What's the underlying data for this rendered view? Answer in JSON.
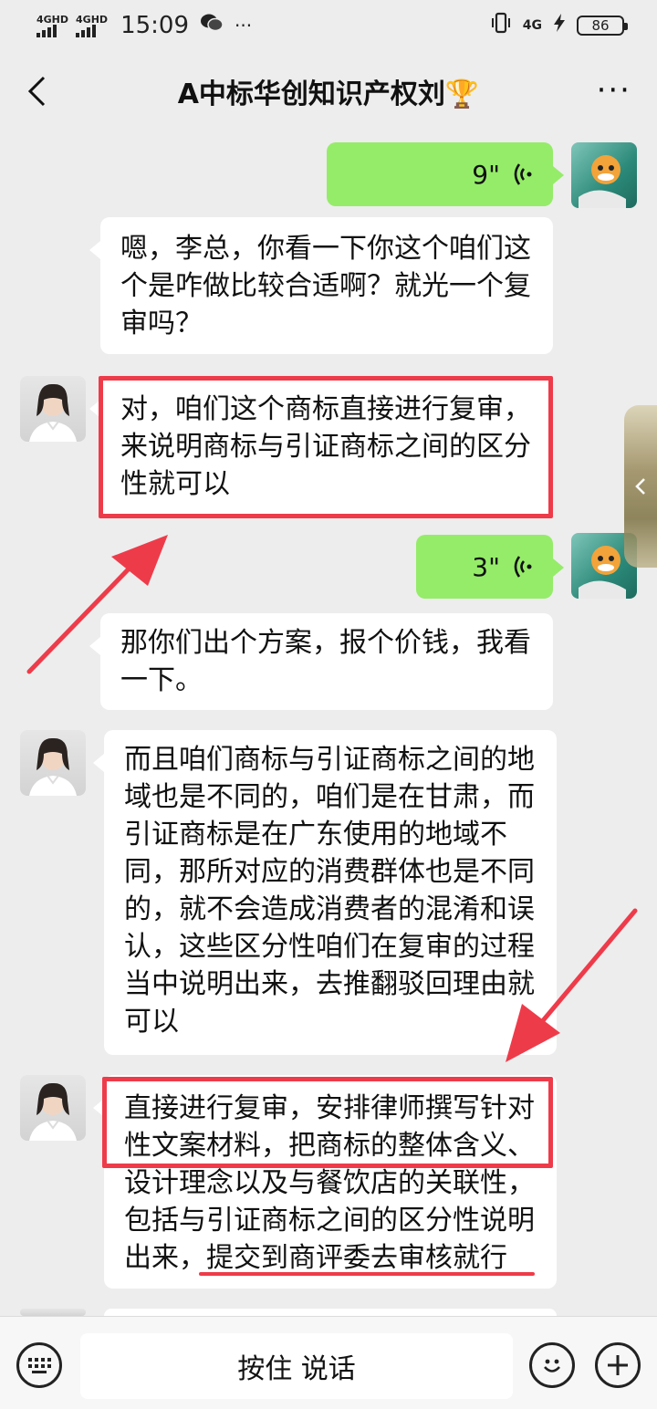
{
  "status_bar": {
    "signal1": "4GHD",
    "signal2": "4GHD",
    "time": "15:09",
    "net_type": "4G",
    "battery": "86"
  },
  "header": {
    "title": "A中标华创知识产权刘🏆",
    "back_icon": "chevron-left-icon",
    "more_label": "···"
  },
  "messages": [
    {
      "side": "right",
      "type": "voice",
      "duration": "9\""
    },
    {
      "side": "left",
      "type": "text",
      "lines": [
        "嗯，李总，你看一下你这个咱们这",
        "个是咋做比较合适啊？就光一个复",
        "审吗？"
      ]
    },
    {
      "side": "left",
      "type": "text",
      "lines": [
        "对，咱们这个商标直接进行复审，",
        "来说明商标与引证商标之间的区分",
        "性就可以"
      ]
    },
    {
      "side": "right",
      "type": "voice",
      "duration": "3\""
    },
    {
      "side": "left",
      "type": "text",
      "lines": [
        "那你们出个方案，报个价钱，我看",
        "一下。"
      ]
    },
    {
      "side": "left",
      "type": "text",
      "lines": [
        "而且咱们商标与引证商标之间的地",
        "域也是不同的，咱们是在甘肃，而",
        "引证商标是在广东使用的地域不",
        "同，那所对应的消费群体也是不同",
        "的，就不会造成消费者的混淆和误",
        "认，这些区分性咱们在复审的过程",
        "当中说明出来，去推翻驳回理由就",
        "可以"
      ]
    },
    {
      "side": "left",
      "type": "text",
      "lines": [
        "直接进行复审，安排律师撰写针对",
        "性文案材料，把商标的整体含义、",
        "设计理念以及与餐饮店的关联性，",
        "包括与引证商标之间的区分性说明",
        "出来，提交到商评委去审核就行"
      ]
    }
  ],
  "input_bar": {
    "talk_label": "按住 说话",
    "keyboard_icon": "keyboard-icon",
    "emoji_icon": "emoji-icon",
    "plus_icon": "plus-icon"
  },
  "colors": {
    "background": "#ededed",
    "self_bubble": "#95ec69",
    "other_bubble": "#ffffff",
    "annotation_red": "#ee3b4a"
  }
}
